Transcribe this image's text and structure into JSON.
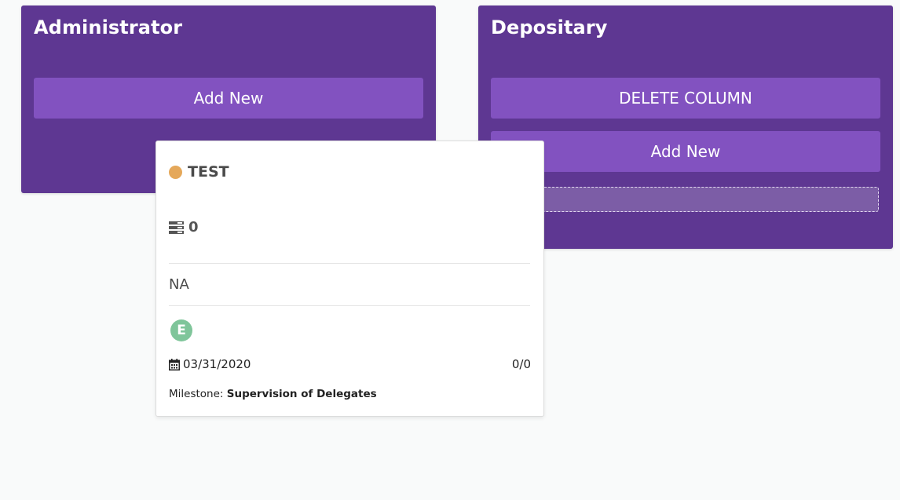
{
  "columns": [
    {
      "title": "Administrator",
      "add_new_label": "Add New"
    },
    {
      "title": "Depositary",
      "delete_label": "DELETE COLUMN",
      "add_new_label": "Add New"
    }
  ],
  "card": {
    "status_color": "#e5a85a",
    "title": "TEST",
    "icon": "stack-icon",
    "count": "0",
    "description": "NA",
    "avatar_initial": "E",
    "avatar_color": "#7fc59a",
    "date_icon": "calendar-icon",
    "date": "03/31/2020",
    "progress": "0/0",
    "milestone_label": "Milestone:",
    "milestone_value": "Supervision of Delegates"
  },
  "colors": {
    "column_bg": "#5e3792",
    "button_bg": "#8252c0",
    "page_bg": "#f9fafa"
  }
}
